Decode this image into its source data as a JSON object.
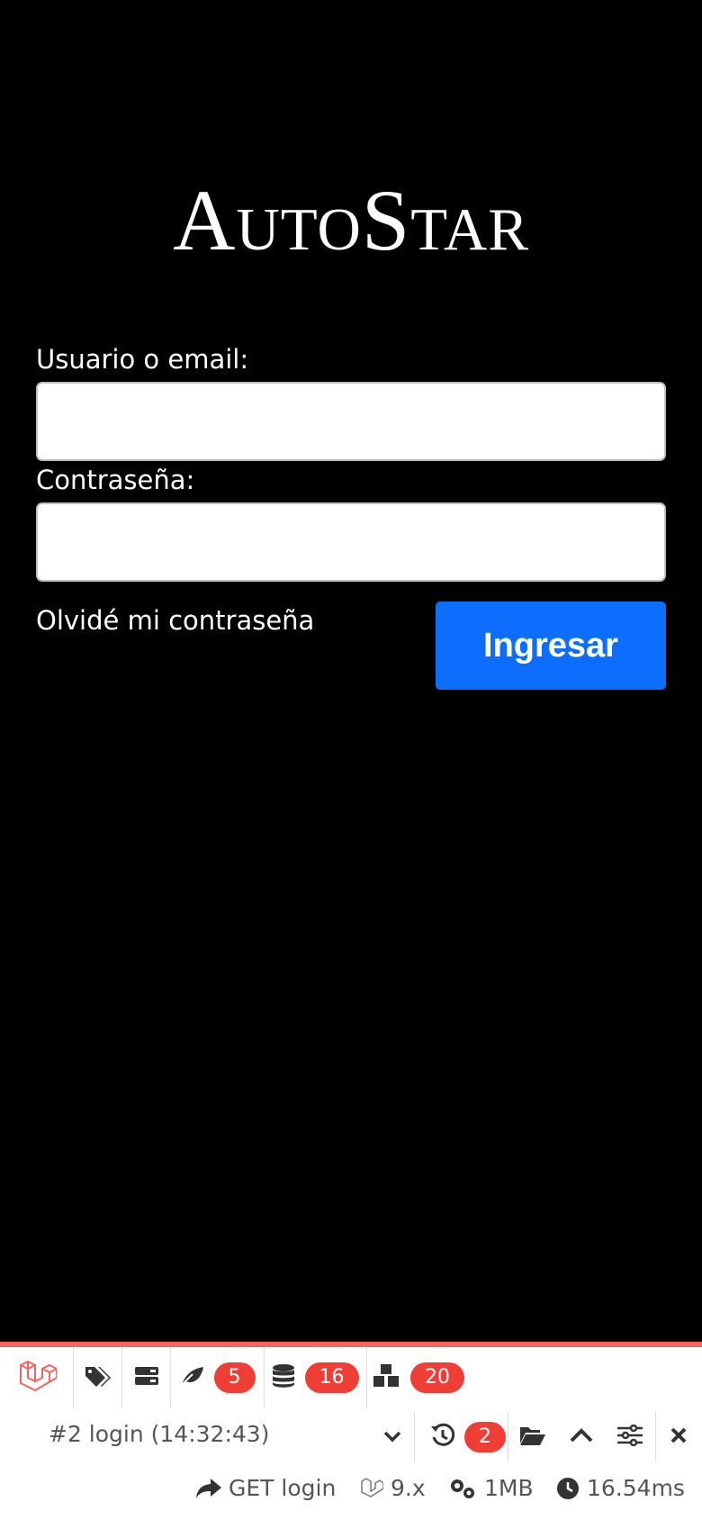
{
  "brand": {
    "logo_text": "AutoStar"
  },
  "form": {
    "username_label": "Usuario o email:",
    "username_value": "",
    "password_label": "Contraseña:",
    "password_value": "",
    "forgot_link": "Olvidé mi contraseña",
    "submit_label": "Ingresar"
  },
  "debugbar": {
    "accent_color": "#f4645f",
    "badge_color": "#ef3e36",
    "tabs": [
      {
        "icon": "laravel-logo-icon"
      },
      {
        "icon": "tags-icon"
      },
      {
        "icon": "server-icon"
      },
      {
        "icon": "leaf-icon",
        "badge": "5"
      },
      {
        "icon": "database-icon",
        "badge": "16"
      },
      {
        "icon": "cubes-icon",
        "badge": "20"
      }
    ],
    "request_label": "#2 login (14:32:43)",
    "history_badge": "2",
    "method_route": "GET login",
    "laravel_version": "9.x",
    "memory": "1MB",
    "duration": "16.54ms"
  },
  "colors": {
    "primary_button": "#0d6efd",
    "background": "#000000"
  }
}
